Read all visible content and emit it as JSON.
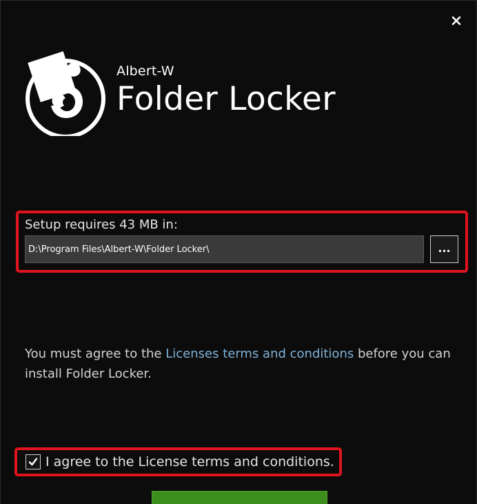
{
  "window": {
    "brand_vendor": "Albert-W",
    "brand_product": "Folder Locker"
  },
  "icons": {
    "close": "close-icon",
    "logo": "puzzle-lock-logo",
    "checkmark": "checkmark-icon"
  },
  "setup": {
    "requirement_label": "Setup requires 43 MB in:",
    "install_path": "D:\\Program Files\\Albert-W\\Folder Locker\\",
    "browse_label": "..."
  },
  "license": {
    "text_before": "You must agree to the ",
    "link_text": "Licenses terms and conditions",
    "text_after": " before you can install Folder Locker."
  },
  "agreement": {
    "checkbox_label": "I agree to the License terms and conditions.",
    "checked": true
  },
  "colors": {
    "background": "#0c0c0c",
    "highlight_border": "#e0141d",
    "link": "#7fb2d8",
    "install_button": "#3e8e1e"
  }
}
